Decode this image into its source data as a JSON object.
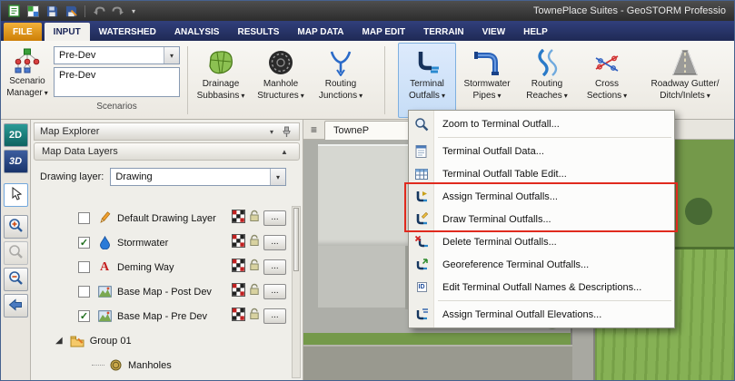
{
  "window": {
    "title": "TownePlace Suites - GeoSTORM Professio"
  },
  "icons": {
    "dropdown_arrow": "▾",
    "collapse_arrow": "▲",
    "check": "✓",
    "expand_triangle": "◢",
    "hamburger": "≡",
    "ellipsis": "...",
    "id_text": "ID",
    "letter_a": "A"
  },
  "titlebar_icons": [
    "new-document-icon",
    "project-grid-icon",
    "save-icon",
    "save-as-icon",
    "undo-icon",
    "redo-icon",
    "quick-access-dropdown"
  ],
  "tabs": [
    {
      "label": "FILE"
    },
    {
      "label": "INPUT",
      "active": true
    },
    {
      "label": "WATERSHED"
    },
    {
      "label": "ANALYSIS"
    },
    {
      "label": "RESULTS"
    },
    {
      "label": "MAP DATA"
    },
    {
      "label": "MAP EDIT"
    },
    {
      "label": "TERRAIN"
    },
    {
      "label": "VIEW"
    },
    {
      "label": "HELP"
    }
  ],
  "ribbon": {
    "scenario_manager": {
      "line1": "Scenario",
      "line2": "Manager"
    },
    "scenario_combo_value": "Pre-Dev",
    "scenario_textbox_value": "Pre-Dev",
    "group_label": "Scenarios",
    "buttons": [
      {
        "line1": "Drainage",
        "line2": "Subbasins",
        "icon": "drainage-subbasins-icon"
      },
      {
        "line1": "Manhole",
        "line2": "Structures",
        "icon": "manhole-structures-icon"
      },
      {
        "line1": "Routing",
        "line2": "Junctions",
        "icon": "routing-junctions-icon"
      },
      {
        "line1": "Terminal",
        "line2": "Outfalls",
        "icon": "terminal-outfalls-icon",
        "selected": true
      },
      {
        "line1": "Stormwater",
        "line2": "Pipes",
        "icon": "stormwater-pipes-icon"
      },
      {
        "line1": "Routing",
        "line2": "Reaches",
        "icon": "routing-reaches-icon"
      },
      {
        "line1": "Cross",
        "line2": "Sections",
        "icon": "cross-sections-icon"
      },
      {
        "line1": "Roadway Gutter/",
        "line2": "Ditch/Inlets",
        "icon": "roadway-gutter-icon"
      }
    ]
  },
  "left_toolbar": {
    "btn_2d": "2D",
    "btn_3d": "3D",
    "tools": [
      "select-pointer",
      "zoom-in",
      "zoom-window",
      "zoom-out",
      "pan-previous"
    ]
  },
  "map_explorer": {
    "title": "Map Explorer",
    "section_title": "Map Data Layers",
    "drawing_layer_label": "Drawing layer:",
    "drawing_layer_value": "Drawing",
    "layers": [
      {
        "label": "Default Drawing Layer",
        "checked": false,
        "icon": "pencil-icon"
      },
      {
        "label": "Stormwater",
        "checked": true,
        "icon": "water-drop-icon"
      },
      {
        "label": "Deming Way",
        "checked": false,
        "icon": "text-label-icon"
      },
      {
        "label": "Base Map - Post Dev",
        "checked": false,
        "icon": "basemap-icon"
      },
      {
        "label": "Base Map - Pre Dev",
        "checked": true,
        "icon": "basemap-icon"
      },
      {
        "label": "Group 01",
        "expanded": true,
        "icon": "group-folder-icon"
      },
      {
        "label": "Manholes",
        "icon": "manhole-layer-icon"
      }
    ]
  },
  "map_view": {
    "tab_label": "TowneP"
  },
  "context_menu": {
    "items": [
      {
        "label": "Zoom to Terminal Outfall...",
        "icon": "zoom-icon"
      },
      {
        "label": "Terminal Outfall Data...",
        "icon": "data-form-icon"
      },
      {
        "label": "Terminal Outfall Table Edit...",
        "icon": "table-edit-icon"
      },
      {
        "label": "Assign Terminal Outfalls...",
        "icon": "assign-outfall-icon",
        "highlighted": true
      },
      {
        "label": "Draw Terminal Outfalls...",
        "icon": "draw-outfall-icon",
        "highlighted": true
      },
      {
        "label": "Delete Terminal Outfalls...",
        "icon": "delete-outfall-icon"
      },
      {
        "label": "Georeference Terminal Outfalls...",
        "icon": "georeference-outfall-icon"
      },
      {
        "label": "Edit Terminal Outfall Names & Descriptions...",
        "icon": "id-badge-icon"
      },
      {
        "label": "Assign Terminal Outfall Elevations...",
        "icon": "elevation-icon"
      }
    ]
  },
  "colors": {
    "highlight_red": "#e02a1e",
    "ribbon_selected_bg": "#cfe3f7",
    "ribbon_selected_border": "#7fb0e0",
    "tabbar_bg": "#25305e",
    "file_tab_orange": "#e09a18"
  }
}
